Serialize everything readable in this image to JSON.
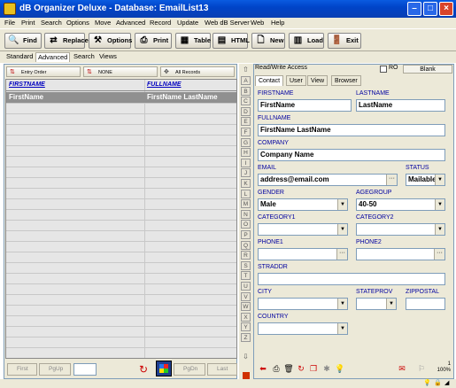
{
  "window": {
    "title": "dB Organizer Deluxe - Database: EmailList13"
  },
  "menu": [
    "File",
    "Print",
    "Search",
    "Options",
    "Move",
    "Advanced",
    "Record",
    "Update",
    "Web dB Server",
    "Web",
    "Help"
  ],
  "toolbar": {
    "find": "Find",
    "replace": "Replace",
    "options": "Options",
    "print": "Print",
    "table": "Table",
    "html": "HTML",
    "new": "New",
    "load": "Load",
    "exit": "Exit"
  },
  "modes": [
    "Standard",
    "Advanced",
    "Search",
    "Views"
  ],
  "left": {
    "entry_order": "Entry Order",
    "sort": "NONE",
    "filter": "All Records"
  },
  "grid": {
    "columns": [
      "FIRSTNAME",
      "FULLNAME"
    ],
    "rows": [
      [
        "FirstName",
        "FirstName LastName"
      ]
    ]
  },
  "nav": {
    "first": "First",
    "pgup": "PgUp",
    "pgdn": "PgDn",
    "last": "Last"
  },
  "alpha": [
    "A",
    "B",
    "C",
    "D",
    "E",
    "F",
    "G",
    "H",
    "I",
    "J",
    "K",
    "L",
    "M",
    "N",
    "O",
    "P",
    "Q",
    "R",
    "S",
    "T",
    "U",
    "V",
    "W",
    "X",
    "Y",
    "Z"
  ],
  "right": {
    "access": "Read/Write Access",
    "ro": "RO",
    "blank": "Blank",
    "tabs": [
      "Contact",
      "User",
      "View",
      "Browser"
    ]
  },
  "form": {
    "firstname_label": "FIRSTNAME",
    "firstname": "FirstName",
    "lastname_label": "LASTNAME",
    "lastname": "LastName",
    "fullname_label": "FULLNAME",
    "fullname": "FirstName LastName",
    "company_label": "COMPANY",
    "company": "Company Name",
    "email_label": "EMAIL",
    "email": "address@email.com",
    "status_label": "STATUS",
    "status": "Mailable",
    "gender_label": "GENDER",
    "gender": "Male",
    "agegroup_label": "AGEGROUP",
    "agegroup": "40-50",
    "category1_label": "CATEGORY1",
    "category2_label": "CATEGORY2",
    "phone1_label": "PHONE1",
    "phone2_label": "PHONE2",
    "straddr_label": "STRADDR",
    "city_label": "CITY",
    "stateprov_label": "STATEPROV",
    "zippostal_label": "ZIPPOSTAL",
    "country_label": "COUNTRY"
  },
  "footer": {
    "record_count": "1",
    "zoom": "100%"
  }
}
